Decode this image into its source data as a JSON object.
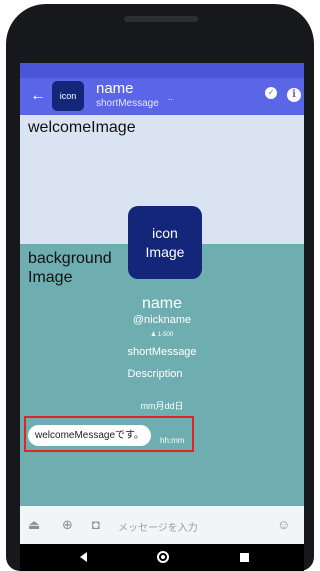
{
  "header": {
    "icon_label": "icon",
    "name": "name",
    "short_message": "shortMessage",
    "dots": "..",
    "back_glyph": "←",
    "check_glyph": "✓",
    "info_glyph": "i"
  },
  "welcome": {
    "label": "welcomeImage"
  },
  "background": {
    "label_line1": "background",
    "label_line2": "Image"
  },
  "profile": {
    "icon_line1": "icon",
    "icon_line2": "Image",
    "name": "name",
    "nickname": "@nickname",
    "friend_count": "♟ 1-500",
    "short_message": "shortMessage",
    "description": "Description"
  },
  "message": {
    "date": "mm月dd日",
    "text": "welcomeMessageです。",
    "time": "hh:mm"
  },
  "input_bar": {
    "placeholder": "メッセージを入力",
    "eject_glyph": "⏏",
    "plus_glyph": "⊕",
    "camera_glyph": "◘",
    "emoji_glyph": "☺"
  },
  "colors": {
    "status_bar": "#4a55d7",
    "header": "#5a66e6",
    "icon_bg": "#13267a",
    "welcome_bg": "#dae3f1",
    "chat_bg": "#6eaeb1",
    "highlight": "#e02424"
  }
}
